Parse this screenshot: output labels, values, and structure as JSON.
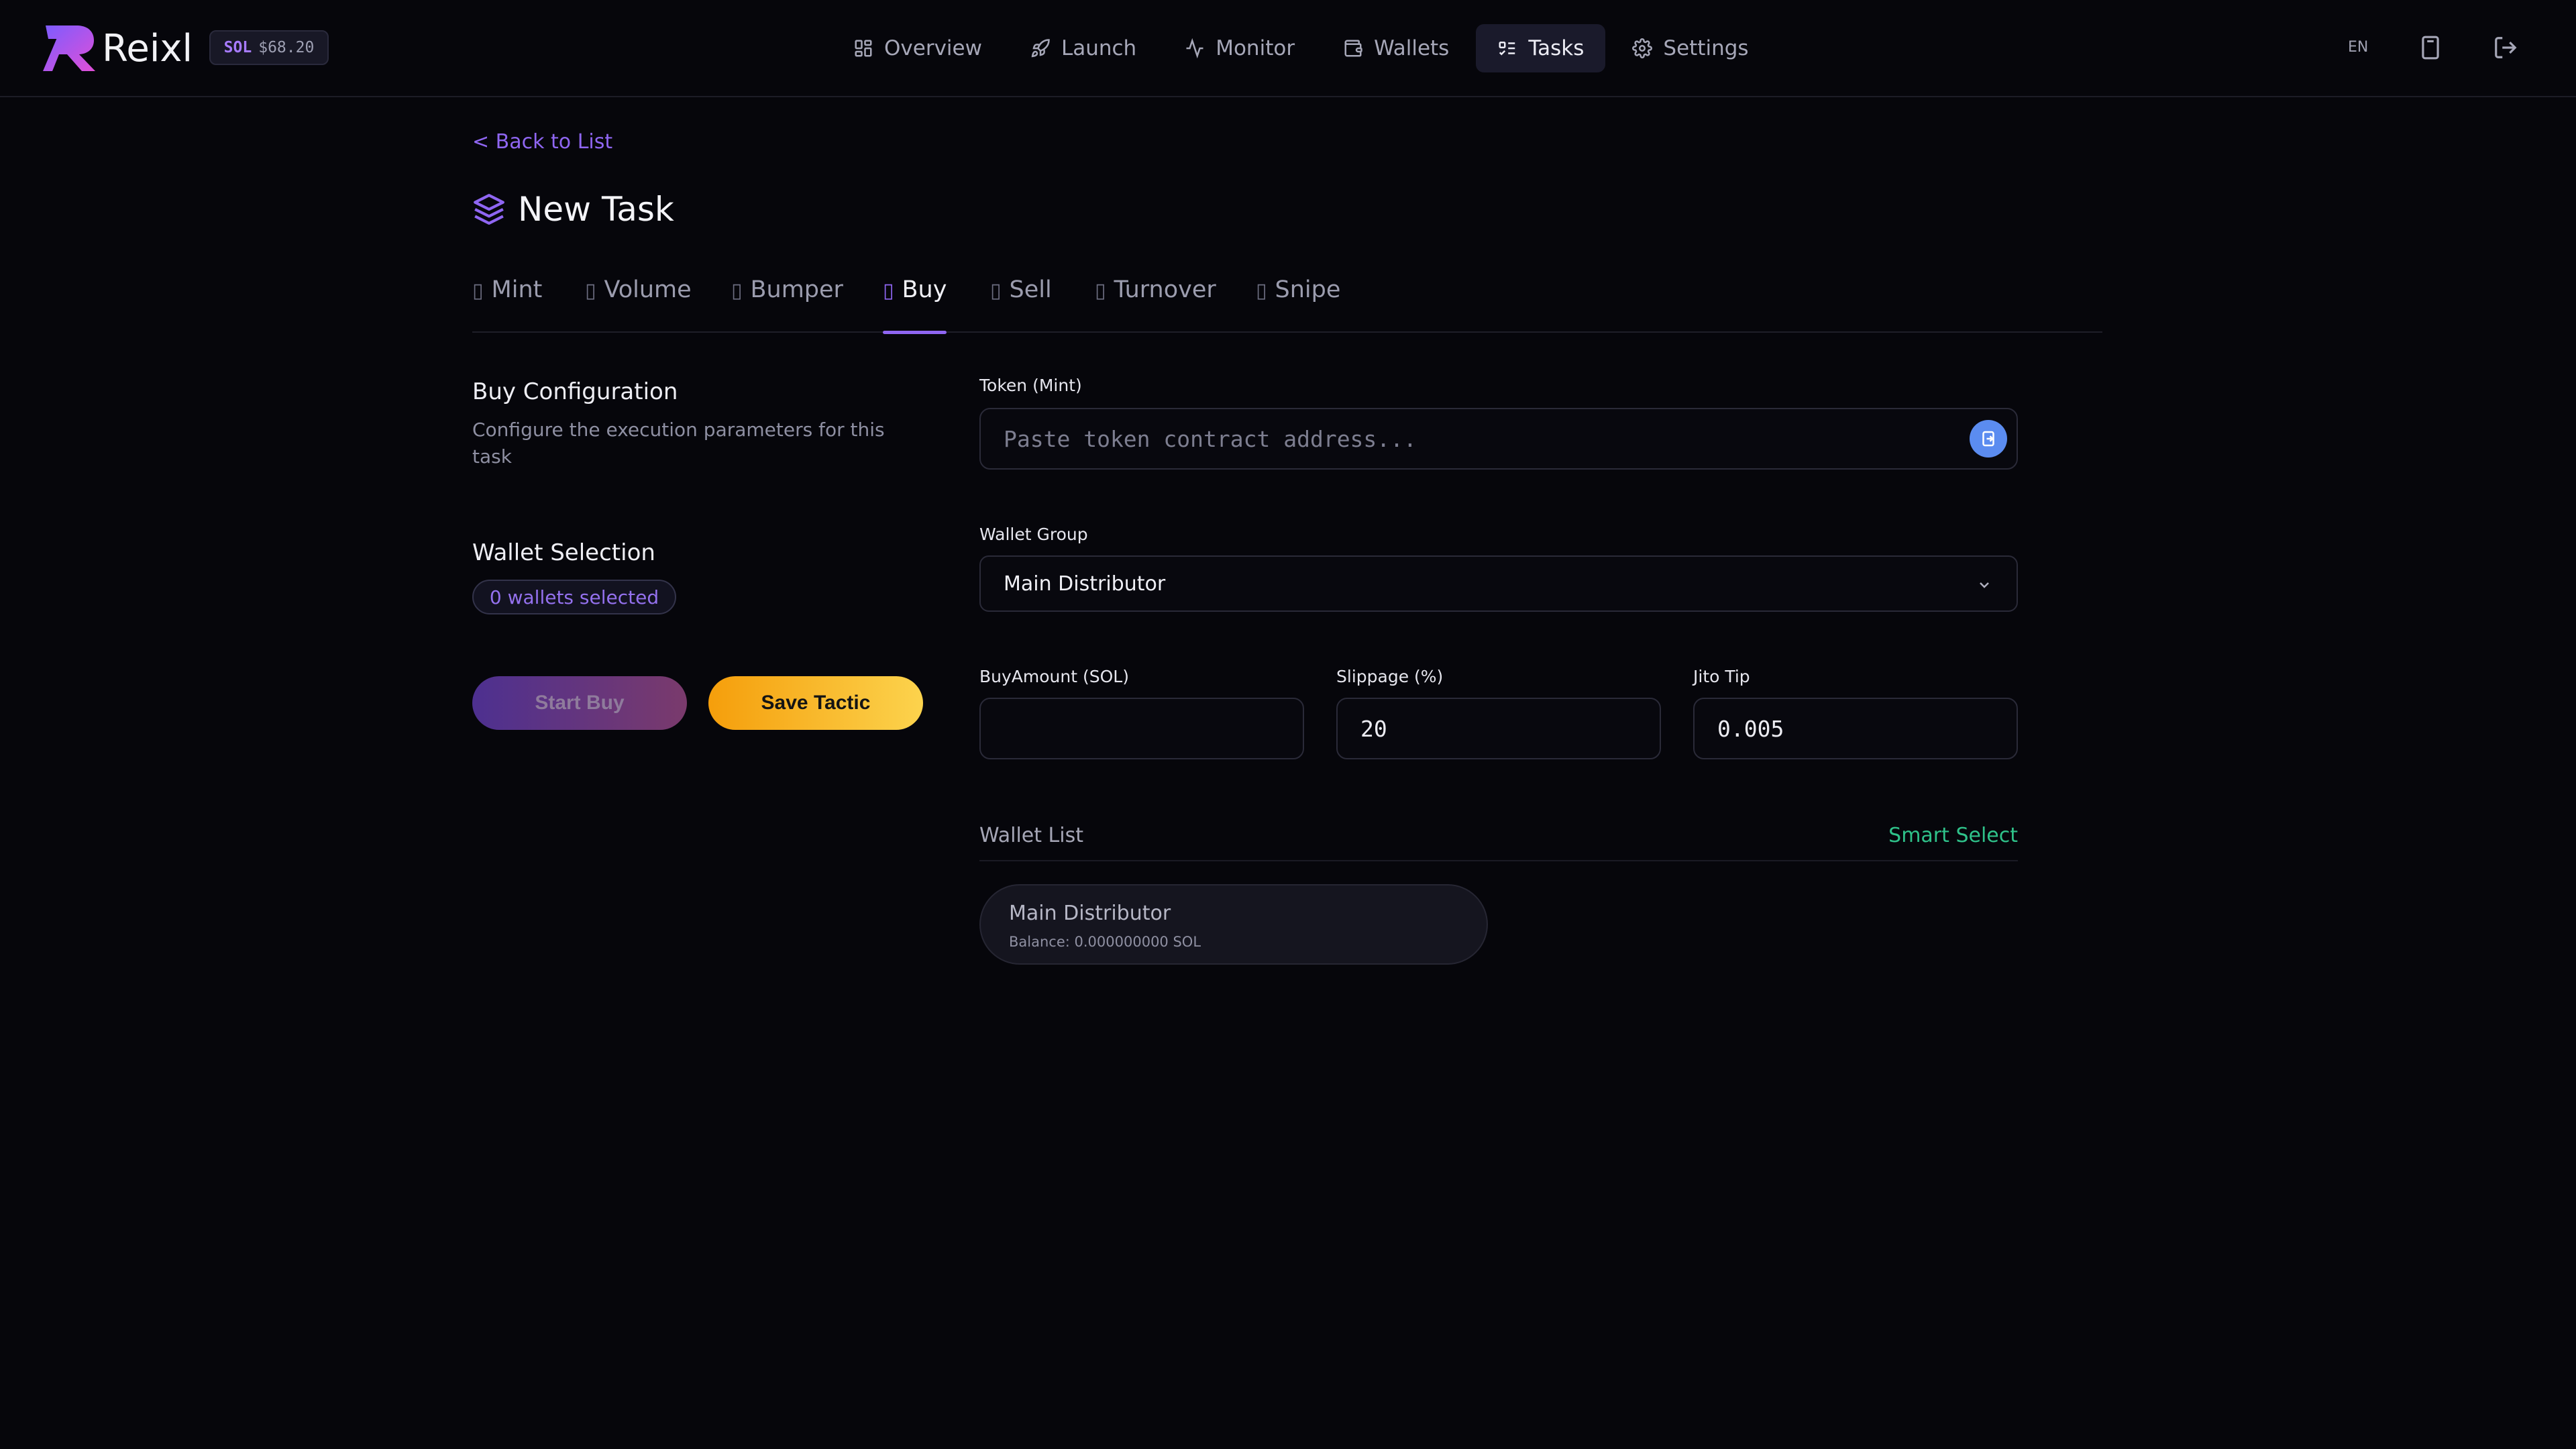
{
  "app": {
    "brand": "Reixl"
  },
  "header": {
    "sol_label": "SOL",
    "sol_price": "$68.20",
    "nav": [
      {
        "label": "Overview",
        "icon": "grid-icon"
      },
      {
        "label": "Launch",
        "icon": "rocket-icon"
      },
      {
        "label": "Monitor",
        "icon": "activity-icon"
      },
      {
        "label": "Wallets",
        "icon": "wallet-icon"
      },
      {
        "label": "Tasks",
        "icon": "list-checks-icon",
        "active": true
      },
      {
        "label": "Settings",
        "icon": "gear-icon"
      }
    ],
    "lang": "EN",
    "right_icons": [
      "calculator-icon",
      "logout-icon"
    ]
  },
  "page": {
    "back_link": "< Back to List",
    "title": "New Task",
    "tabs": [
      {
        "label": "Mint"
      },
      {
        "label": "Volume"
      },
      {
        "label": "Bumper"
      },
      {
        "label": "Buy",
        "active": true
      },
      {
        "label": "Sell"
      },
      {
        "label": "Turnover"
      },
      {
        "label": "Snipe"
      }
    ]
  },
  "config": {
    "title": "Buy Configuration",
    "description": "Configure the execution parameters for this task",
    "wallet_selection_title": "Wallet Selection",
    "wallets_selected": "0 wallets selected",
    "start_button": "Start Buy",
    "save_button": "Save Tactic"
  },
  "form": {
    "token_label": "Token (Mint)",
    "token_value": "",
    "token_placeholder": "Paste token contract address...",
    "wallet_group_label": "Wallet Group",
    "wallet_group_value": "Main Distributor",
    "buy_amount_label": "BuyAmount (SOL)",
    "buy_amount_value": "",
    "slippage_label": "Slippage (%)",
    "slippage_value": "20",
    "jito_label": "Jito Tip",
    "jito_value": "0.005"
  },
  "wallet_list": {
    "title": "Wallet List",
    "smart_select": "Smart Select",
    "items": [
      {
        "name": "Main Distributor",
        "balance": "Balance: 0.000000000 SOL"
      }
    ]
  },
  "colors": {
    "background": "#06060b",
    "accent_purple": "#8f66f2",
    "accent_green": "#2fc28a",
    "save_gradient_start": "#f59e0b",
    "save_gradient_end": "#fcd34d"
  }
}
